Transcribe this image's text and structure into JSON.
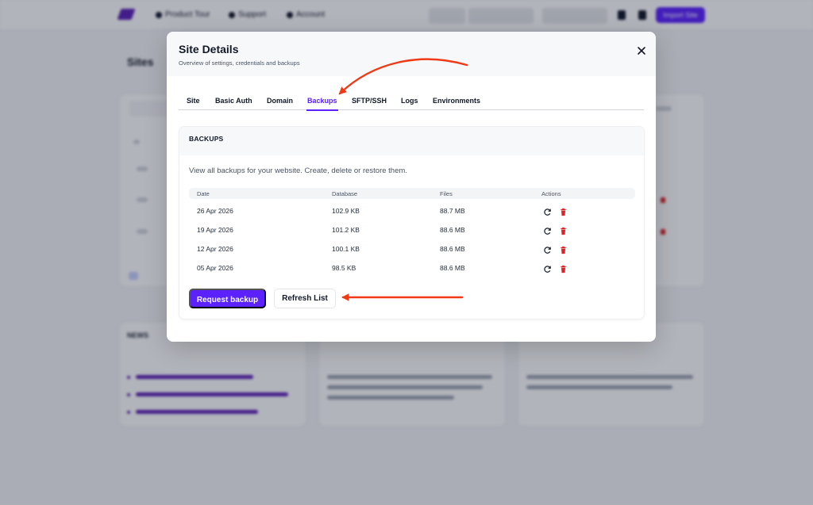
{
  "background": {
    "nav": [
      "Product Tour",
      "Support",
      "Account"
    ],
    "import_button": "Import Site",
    "page_title": "Sites",
    "news_title": "NEWS"
  },
  "modal": {
    "title": "Site Details",
    "subtitle": "Overview of settings, credentials and backups",
    "close_icon": "close-icon",
    "tabs": [
      {
        "label": "Site"
      },
      {
        "label": "Basic Auth"
      },
      {
        "label": "Domain"
      },
      {
        "label": "Backups",
        "active": true
      },
      {
        "label": "SFTP/SSH"
      },
      {
        "label": "Logs"
      },
      {
        "label": "Environments"
      }
    ],
    "backups": {
      "heading": "BACKUPS",
      "description": "View all backups for your website. Create, delete or restore them.",
      "columns": [
        "Date",
        "Database",
        "Files",
        "Actions"
      ],
      "rows": [
        {
          "date": "26 Apr 2026",
          "database": "102.9 KB",
          "files": "88.7 MB"
        },
        {
          "date": "19 Apr 2026",
          "database": "101.2 KB",
          "files": "88.6 MB"
        },
        {
          "date": "12 Apr 2026",
          "database": "100.1 KB",
          "files": "88.6 MB"
        },
        {
          "date": "05 Apr 2026",
          "database": "98.5 KB",
          "files": "88.6 MB"
        }
      ],
      "row_action_icons": [
        "restore-icon",
        "delete-icon"
      ],
      "request_button": "Request backup",
      "refresh_button": "Refresh List"
    }
  },
  "colors": {
    "accent": "#5b21ff",
    "danger": "#dc2626",
    "annotation_arrow": "#f03a17"
  }
}
